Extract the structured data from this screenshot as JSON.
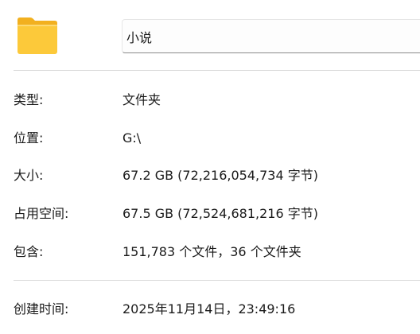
{
  "folder": {
    "icon": "folder-icon",
    "name": "小说"
  },
  "properties": [
    {
      "label": "类型:",
      "value": "文件夹"
    },
    {
      "label": "位置:",
      "value": "G:\\"
    },
    {
      "label": "大小:",
      "value": "67.2 GB (72,216,054,734 字节)"
    },
    {
      "label": "占用空间:",
      "value": "67.5 GB (72,524,681,216 字节)"
    },
    {
      "label": "包含:",
      "value": "151,783 个文件，36 个文件夹"
    }
  ],
  "timestamps": [
    {
      "label": "创建时间:",
      "value": "2025年11月14日，23:49:16"
    }
  ],
  "colors": {
    "folder_body": "#fcc93a",
    "folder_tab": "#f2b01f",
    "divider": "#d9d9d9"
  }
}
